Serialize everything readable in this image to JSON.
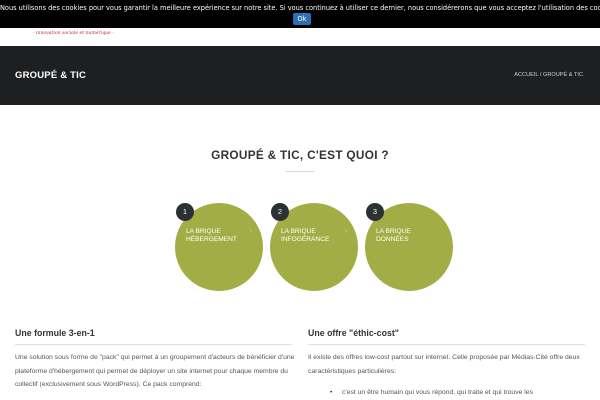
{
  "cookie_bar": {
    "message": "Nous utilisons des cookies pour vous garantir la meilleure expérience sur notre site. Si vous continuez à utiliser ce dernier, nous considérerons que vous acceptez l'utilisation des cookies.",
    "ok_label": "Ok"
  },
  "header": {
    "tagline": "- innovation sociale et numérique -"
  },
  "title_band": {
    "page_title": "GROUPÉ & TIC",
    "breadcrumb": {
      "home": "ACCUEIL",
      "separator": "/",
      "current": "GROUPÉ & TIC"
    }
  },
  "main": {
    "heading": "GROUPÉ & TIC, C'EST QUOI ?",
    "steps": [
      {
        "number": "1",
        "label": "La brique\nhébergement"
      },
      {
        "number": "2",
        "label": "La brique\ninfogérance"
      },
      {
        "number": "3",
        "label": "La brique\ndonnées"
      }
    ],
    "chevron": "›",
    "colors": {
      "step_green": "#a2ae45",
      "step_number_bg": "#2c3134",
      "title_band_bg": "#1e1f21",
      "cookie_ok_bg": "#2d6fb3"
    }
  },
  "left_column": {
    "title": "Une formule 3-en-1",
    "text": "Une solution sous forme de \"pack\" qui permet à un groupement d'acteurs de bénéficier d'une plateforme d'hébergement qui permet de déployer un site internet pour chaque membre du collectif (exclusivement sous WordPress). Ce pack comprend:"
  },
  "right_column": {
    "title": "Une offre \"éthic-cost\"",
    "text": "Il existe des offres low-cost partout sur internet. Celle proposée par Médias-Cité offre deux caractéristiques particulières:",
    "bullets": [
      "c'est un être humain qui vous répond, qui traite et qui trouve les"
    ]
  }
}
